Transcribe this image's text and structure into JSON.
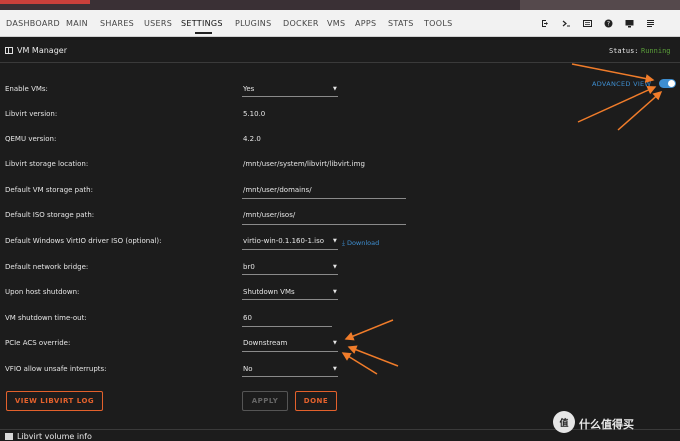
{
  "nav": {
    "items": [
      "DASHBOARD",
      "MAIN",
      "SHARES",
      "USERS",
      "SETTINGS",
      "PLUGINS",
      "DOCKER",
      "VMS",
      "APPS",
      "STATS",
      "TOOLS"
    ],
    "active": "SETTINGS",
    "icons": [
      "logout-icon",
      "terminal-icon",
      "feedback-icon",
      "help-icon",
      "monitor-icon",
      "log-icon"
    ]
  },
  "panel": {
    "title": "VM Manager",
    "status_label": "Status:",
    "status_value": "Running",
    "advanced_view_label": "ADVANCED VIEW",
    "advanced_view_on": true
  },
  "settings": [
    {
      "label": "Enable VMs:",
      "value": "Yes",
      "type": "select"
    },
    {
      "label": "Libvirt version:",
      "value": "5.10.0",
      "type": "text"
    },
    {
      "label": "QEMU version:",
      "value": "4.2.0",
      "type": "text"
    },
    {
      "label": "Libvirt storage location:",
      "value": "/mnt/user/system/libvirt/libvirt.img",
      "type": "text"
    },
    {
      "label": "Default VM storage path:",
      "value": "/mnt/user/domains/",
      "type": "input"
    },
    {
      "label": "Default ISO storage path:",
      "value": "/mnt/user/isos/",
      "type": "input"
    },
    {
      "label": "Default Windows VirtIO driver ISO (optional):",
      "value": "virtio-win-0.1.160-1.iso",
      "type": "select"
    },
    {
      "label": "Default network bridge:",
      "value": "br0",
      "type": "select"
    },
    {
      "label": "Upon host shutdown:",
      "value": "Shutdown VMs",
      "type": "select"
    },
    {
      "label": "VM shutdown time-out:",
      "value": "60",
      "type": "input"
    },
    {
      "label": "PCIe ACS override:",
      "value": "Downstream",
      "type": "select"
    },
    {
      "label": "VFIO allow unsafe interrupts:",
      "value": "No",
      "type": "select"
    }
  ],
  "download_label": "Download",
  "buttons": {
    "view_log": "VIEW LIBVIRT LOG",
    "apply": "APPLY",
    "done": "DONE"
  },
  "footer": {
    "title": "Libvirt volume info"
  },
  "watermark": {
    "badge": "值",
    "text": "什么值得买"
  },
  "colors": {
    "accent": "#e3612c",
    "link": "#3e8ed0",
    "running": "#5a9e3a",
    "annotation": "#f07c2a"
  }
}
